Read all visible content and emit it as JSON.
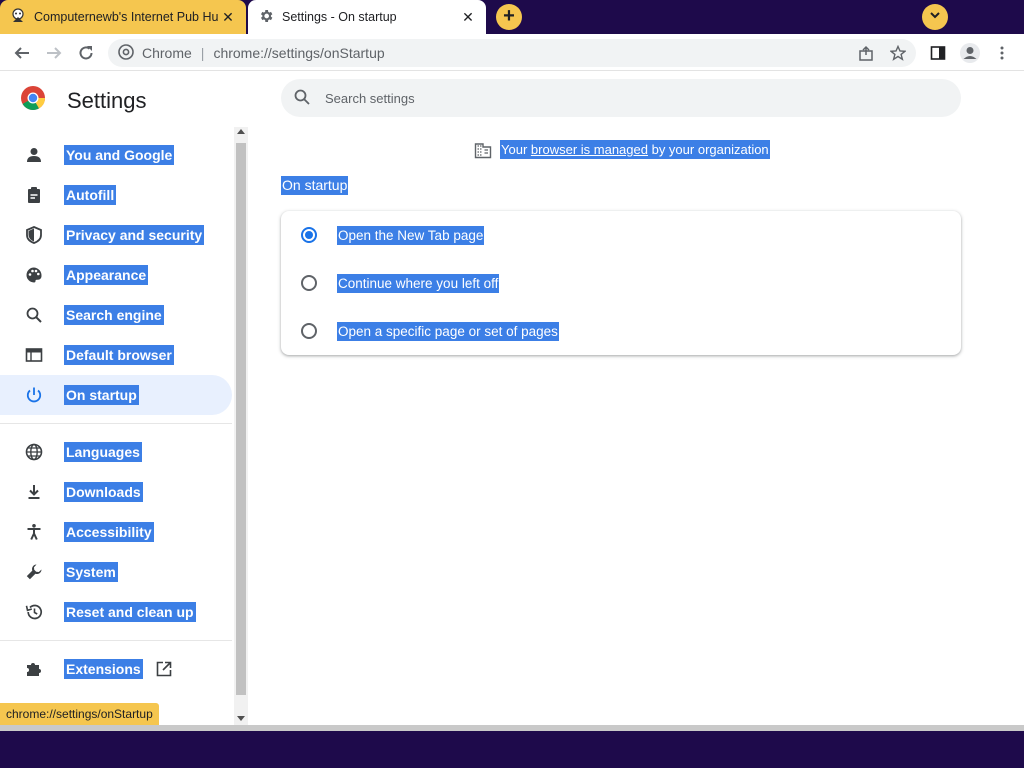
{
  "tabs": [
    {
      "title": "Computernewb's Internet Pub Hu",
      "icon": "computernewb-favicon",
      "close": "✕"
    },
    {
      "title": "Settings - On startup",
      "icon": "gear-icon",
      "close": "✕"
    }
  ],
  "newtab_label": "+",
  "omnibox": {
    "chip": "Chrome",
    "separator": "|",
    "url": "chrome://settings/onStartup"
  },
  "page": {
    "title": "Settings",
    "search_placeholder": "Search settings"
  },
  "sidebar": {
    "items": [
      {
        "label": "You and Google",
        "icon": "person-icon"
      },
      {
        "label": "Autofill",
        "icon": "clipboard-icon"
      },
      {
        "label": "Privacy and security",
        "icon": "shield-icon"
      },
      {
        "label": "Appearance",
        "icon": "palette-icon"
      },
      {
        "label": "Search engine",
        "icon": "search-icon"
      },
      {
        "label": "Default browser",
        "icon": "browser-window-icon"
      },
      {
        "label": "On startup",
        "icon": "power-icon",
        "active": true
      },
      {
        "label": "Languages",
        "icon": "globe-icon"
      },
      {
        "label": "Downloads",
        "icon": "download-icon"
      },
      {
        "label": "Accessibility",
        "icon": "accessibility-icon"
      },
      {
        "label": "System",
        "icon": "wrench-icon"
      },
      {
        "label": "Reset and clean up",
        "icon": "reset-icon"
      },
      {
        "label": "Extensions",
        "icon": "puzzle-icon"
      }
    ]
  },
  "managed": {
    "prefix": "Your",
    "link": "browser is managed",
    "suffix": "by your organization"
  },
  "section": {
    "title": "On startup"
  },
  "startup_options": [
    {
      "label": "Open the New Tab page",
      "checked": true
    },
    {
      "label": "Continue where you left off",
      "checked": false
    },
    {
      "label": "Open a specific page or set of pages",
      "checked": false
    }
  ],
  "status_url": "chrome://settings/onStartup",
  "colors": {
    "accent": "#1a73e8",
    "selection": "#3c7fe6",
    "tab_active": "#f5c64f",
    "taskbar": "#1e0a4b"
  }
}
